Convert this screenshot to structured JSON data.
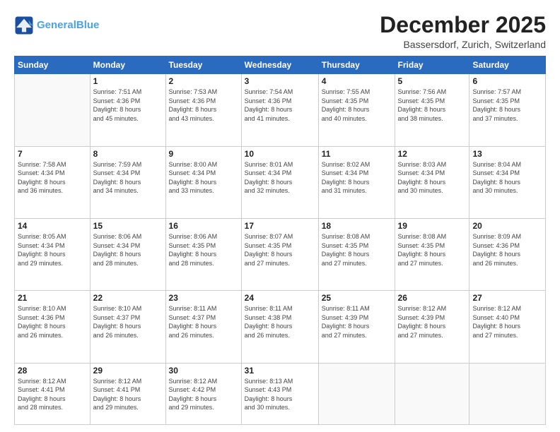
{
  "header": {
    "logo_line1": "General",
    "logo_line2": "Blue",
    "month_title": "December 2025",
    "location": "Bassersdorf, Zurich, Switzerland"
  },
  "days_of_week": [
    "Sunday",
    "Monday",
    "Tuesday",
    "Wednesday",
    "Thursday",
    "Friday",
    "Saturday"
  ],
  "weeks": [
    [
      {
        "day": "",
        "info": ""
      },
      {
        "day": "1",
        "info": "Sunrise: 7:51 AM\nSunset: 4:36 PM\nDaylight: 8 hours\nand 45 minutes."
      },
      {
        "day": "2",
        "info": "Sunrise: 7:53 AM\nSunset: 4:36 PM\nDaylight: 8 hours\nand 43 minutes."
      },
      {
        "day": "3",
        "info": "Sunrise: 7:54 AM\nSunset: 4:36 PM\nDaylight: 8 hours\nand 41 minutes."
      },
      {
        "day": "4",
        "info": "Sunrise: 7:55 AM\nSunset: 4:35 PM\nDaylight: 8 hours\nand 40 minutes."
      },
      {
        "day": "5",
        "info": "Sunrise: 7:56 AM\nSunset: 4:35 PM\nDaylight: 8 hours\nand 38 minutes."
      },
      {
        "day": "6",
        "info": "Sunrise: 7:57 AM\nSunset: 4:35 PM\nDaylight: 8 hours\nand 37 minutes."
      }
    ],
    [
      {
        "day": "7",
        "info": "Sunrise: 7:58 AM\nSunset: 4:34 PM\nDaylight: 8 hours\nand 36 minutes."
      },
      {
        "day": "8",
        "info": "Sunrise: 7:59 AM\nSunset: 4:34 PM\nDaylight: 8 hours\nand 34 minutes."
      },
      {
        "day": "9",
        "info": "Sunrise: 8:00 AM\nSunset: 4:34 PM\nDaylight: 8 hours\nand 33 minutes."
      },
      {
        "day": "10",
        "info": "Sunrise: 8:01 AM\nSunset: 4:34 PM\nDaylight: 8 hours\nand 32 minutes."
      },
      {
        "day": "11",
        "info": "Sunrise: 8:02 AM\nSunset: 4:34 PM\nDaylight: 8 hours\nand 31 minutes."
      },
      {
        "day": "12",
        "info": "Sunrise: 8:03 AM\nSunset: 4:34 PM\nDaylight: 8 hours\nand 30 minutes."
      },
      {
        "day": "13",
        "info": "Sunrise: 8:04 AM\nSunset: 4:34 PM\nDaylight: 8 hours\nand 30 minutes."
      }
    ],
    [
      {
        "day": "14",
        "info": "Sunrise: 8:05 AM\nSunset: 4:34 PM\nDaylight: 8 hours\nand 29 minutes."
      },
      {
        "day": "15",
        "info": "Sunrise: 8:06 AM\nSunset: 4:34 PM\nDaylight: 8 hours\nand 28 minutes."
      },
      {
        "day": "16",
        "info": "Sunrise: 8:06 AM\nSunset: 4:35 PM\nDaylight: 8 hours\nand 28 minutes."
      },
      {
        "day": "17",
        "info": "Sunrise: 8:07 AM\nSunset: 4:35 PM\nDaylight: 8 hours\nand 27 minutes."
      },
      {
        "day": "18",
        "info": "Sunrise: 8:08 AM\nSunset: 4:35 PM\nDaylight: 8 hours\nand 27 minutes."
      },
      {
        "day": "19",
        "info": "Sunrise: 8:08 AM\nSunset: 4:35 PM\nDaylight: 8 hours\nand 27 minutes."
      },
      {
        "day": "20",
        "info": "Sunrise: 8:09 AM\nSunset: 4:36 PM\nDaylight: 8 hours\nand 26 minutes."
      }
    ],
    [
      {
        "day": "21",
        "info": "Sunrise: 8:10 AM\nSunset: 4:36 PM\nDaylight: 8 hours\nand 26 minutes."
      },
      {
        "day": "22",
        "info": "Sunrise: 8:10 AM\nSunset: 4:37 PM\nDaylight: 8 hours\nand 26 minutes."
      },
      {
        "day": "23",
        "info": "Sunrise: 8:11 AM\nSunset: 4:37 PM\nDaylight: 8 hours\nand 26 minutes."
      },
      {
        "day": "24",
        "info": "Sunrise: 8:11 AM\nSunset: 4:38 PM\nDaylight: 8 hours\nand 26 minutes."
      },
      {
        "day": "25",
        "info": "Sunrise: 8:11 AM\nSunset: 4:39 PM\nDaylight: 8 hours\nand 27 minutes."
      },
      {
        "day": "26",
        "info": "Sunrise: 8:12 AM\nSunset: 4:39 PM\nDaylight: 8 hours\nand 27 minutes."
      },
      {
        "day": "27",
        "info": "Sunrise: 8:12 AM\nSunset: 4:40 PM\nDaylight: 8 hours\nand 27 minutes."
      }
    ],
    [
      {
        "day": "28",
        "info": "Sunrise: 8:12 AM\nSunset: 4:41 PM\nDaylight: 8 hours\nand 28 minutes."
      },
      {
        "day": "29",
        "info": "Sunrise: 8:12 AM\nSunset: 4:41 PM\nDaylight: 8 hours\nand 29 minutes."
      },
      {
        "day": "30",
        "info": "Sunrise: 8:12 AM\nSunset: 4:42 PM\nDaylight: 8 hours\nand 29 minutes."
      },
      {
        "day": "31",
        "info": "Sunrise: 8:13 AM\nSunset: 4:43 PM\nDaylight: 8 hours\nand 30 minutes."
      },
      {
        "day": "",
        "info": ""
      },
      {
        "day": "",
        "info": ""
      },
      {
        "day": "",
        "info": ""
      }
    ]
  ]
}
